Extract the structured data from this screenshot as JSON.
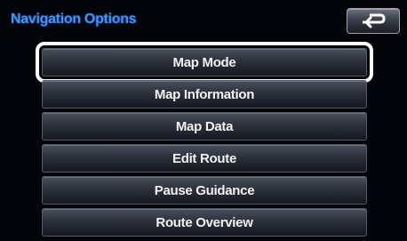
{
  "header": {
    "title": "Navigation Options"
  },
  "back_button": {
    "icon": "back-arrow-icon"
  },
  "menu": {
    "items": [
      {
        "label": "Map Mode",
        "selected": true
      },
      {
        "label": "Map Information",
        "selected": false
      },
      {
        "label": "Map Data",
        "selected": false
      },
      {
        "label": "Edit Route",
        "selected": false
      },
      {
        "label": "Pause Guidance",
        "selected": false
      },
      {
        "label": "Route Overview",
        "selected": false
      }
    ]
  },
  "colors": {
    "title": "#3f93ff",
    "selection_outline": "#ffffff"
  }
}
